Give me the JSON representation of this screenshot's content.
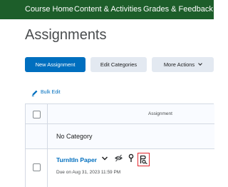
{
  "nav": {
    "items": [
      "Course Home",
      "Content & Activities",
      "Grades & Feedback"
    ],
    "background": "#1d5e2a"
  },
  "page": {
    "title": "Assignments"
  },
  "toolbar": {
    "new_label": "New Assignment",
    "edit_categories_label": "Edit Categories",
    "more_actions_label": "More Actions"
  },
  "bulk_edit": {
    "label": "Bulk Edit"
  },
  "table": {
    "column_header": "Assignment",
    "category_label": "No Category",
    "rows": [
      {
        "title": "TurnItIn Paper",
        "due": "Due on Aug 31, 2023 11:59 PM"
      }
    ]
  },
  "icons": {
    "nav_dropdown": "chevron-down-icon",
    "bulk_edit": "pencil-icon",
    "row_menu": "chevron-down-icon",
    "visibility": "eye-slash-icon",
    "restrictions": "pin-icon",
    "turnitin": "turnitin-icon"
  },
  "colors": {
    "accent": "#006fbf",
    "highlight": "#e0282e",
    "button_secondary": "#e3e9f1"
  }
}
